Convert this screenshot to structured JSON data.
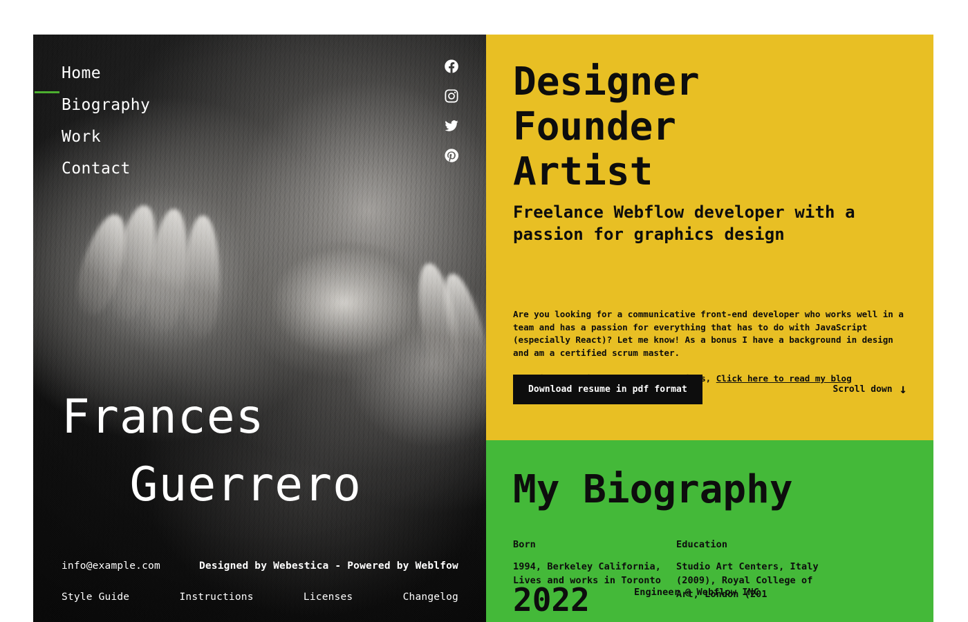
{
  "theme": {
    "dark": "#121212",
    "yellow": "#E8BF24",
    "green": "#44B939",
    "accent_green": "#4CAF2F",
    "text_light": "#FFFFFF",
    "text_dark": "#0D0D0D"
  },
  "nav": {
    "items": [
      {
        "label": "Home",
        "active": true
      },
      {
        "label": "Biography",
        "active": false
      },
      {
        "label": "Work",
        "active": false
      },
      {
        "label": "Contact",
        "active": false
      }
    ]
  },
  "social": {
    "items": [
      {
        "name": "facebook-icon",
        "label": "Facebook"
      },
      {
        "name": "instagram-icon",
        "label": "Instagram"
      },
      {
        "name": "twitter-icon",
        "label": "Twitter"
      },
      {
        "name": "pinterest-icon",
        "label": "Pinterest"
      }
    ]
  },
  "hero": {
    "name_line1": "Frances",
    "name_line2": "Guerrero"
  },
  "footer": {
    "email": "info@example.com",
    "credit": "Designed by Webestica - Powered by Weblfow",
    "links": [
      {
        "label": "Style Guide"
      },
      {
        "label": "Instructions"
      },
      {
        "label": "Licenses"
      },
      {
        "label": "Changelog"
      }
    ]
  },
  "intro": {
    "heading_line1": "Designer",
    "heading_line2": "Founder",
    "heading_line3": "Artist",
    "tagline": "Freelance Webflow developer with a passion for graphics design",
    "paragraph": "Are you looking for a communicative front-end developer who works well in a team and has a passion for everything that has to do with JavaScript (especially React)? Let me know! As a bonus I have a background in design and am a certified scrum master.",
    "blog_intro": "Sometimes I write about random things, ",
    "blog_link": "Click here to read my blog",
    "download_button": "Download resume in pdf format",
    "scroll_label": "Scroll down",
    "scroll_arrow": "↓"
  },
  "biography": {
    "heading": "My Biography",
    "columns": [
      {
        "title": "Born",
        "body": "1994, Berkeley California, Lives and works in Toronto"
      },
      {
        "title": "Education",
        "body": "Studio Art Centers, Italy (2009), Royal College of Art, London (201"
      }
    ],
    "timeline": [
      {
        "year": "2022",
        "role": "Engineer @ Webflow INC"
      }
    ]
  }
}
